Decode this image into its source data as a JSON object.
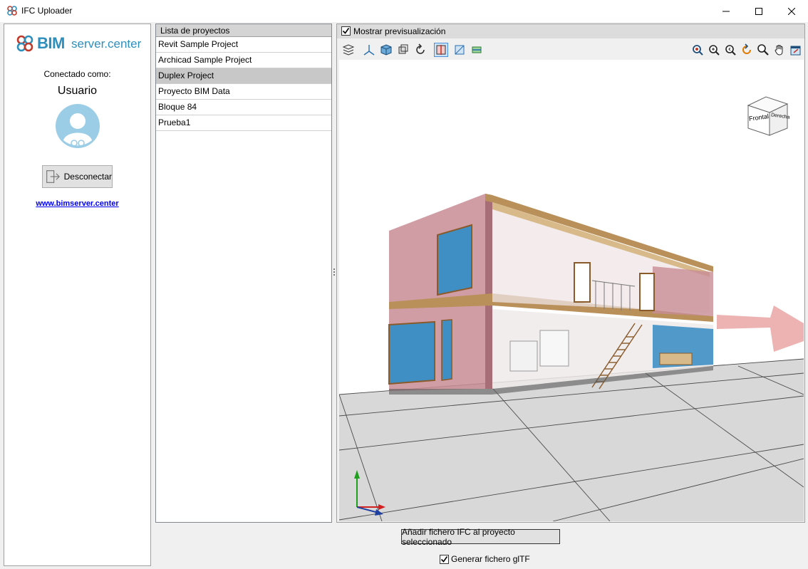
{
  "window": {
    "title": "IFC Uploader",
    "controls": [
      "minimize",
      "maximize",
      "close"
    ]
  },
  "sidebar": {
    "logo_bim": "BIM",
    "logo_rest": "server.center",
    "connected_label": "Conectado como:",
    "username": "Usuario",
    "disconnect_label": "Desconectar",
    "website_link": "www.bimserver.center"
  },
  "projects": {
    "header": "Lista de proyectos",
    "items": [
      {
        "label": "Revit Sample Project"
      },
      {
        "label": "Archicad Sample Project"
      },
      {
        "label": "Duplex Project"
      },
      {
        "label": "Proyecto BIM Data"
      },
      {
        "label": "Bloque 84"
      },
      {
        "label": "Prueba1"
      }
    ],
    "selected_index": 2
  },
  "preview": {
    "show_preview_label": "Mostrar previsualización",
    "show_preview_checked": true,
    "view_cube": {
      "front": "Frontal",
      "right": "Derecha"
    },
    "toolbar_left": [
      "layers-icon",
      "axes-icon",
      "box-3d-icon",
      "orbit-icon",
      "reset-rotation-icon",
      "section-plane-icon",
      "section-box-icon",
      "floor-plan-icon"
    ],
    "toolbar_right": [
      "zoom-window-icon",
      "zoom-extents-icon",
      "zoom-previous-icon",
      "refresh-view-icon",
      "zoom-icon",
      "pan-hand-icon",
      "export-view-icon"
    ],
    "colors": {
      "accent": "#2e8fbd",
      "ground": "#d6d6d6",
      "wall": "#c88c95",
      "glass": "#3f8fc4",
      "wood": "#b9905a"
    }
  },
  "actions": {
    "add_ifc_label": "Añadir fichero IFC al proyecto seleccionado",
    "generate_gltf_label": "Generar fichero glTF",
    "generate_gltf_checked": true
  }
}
